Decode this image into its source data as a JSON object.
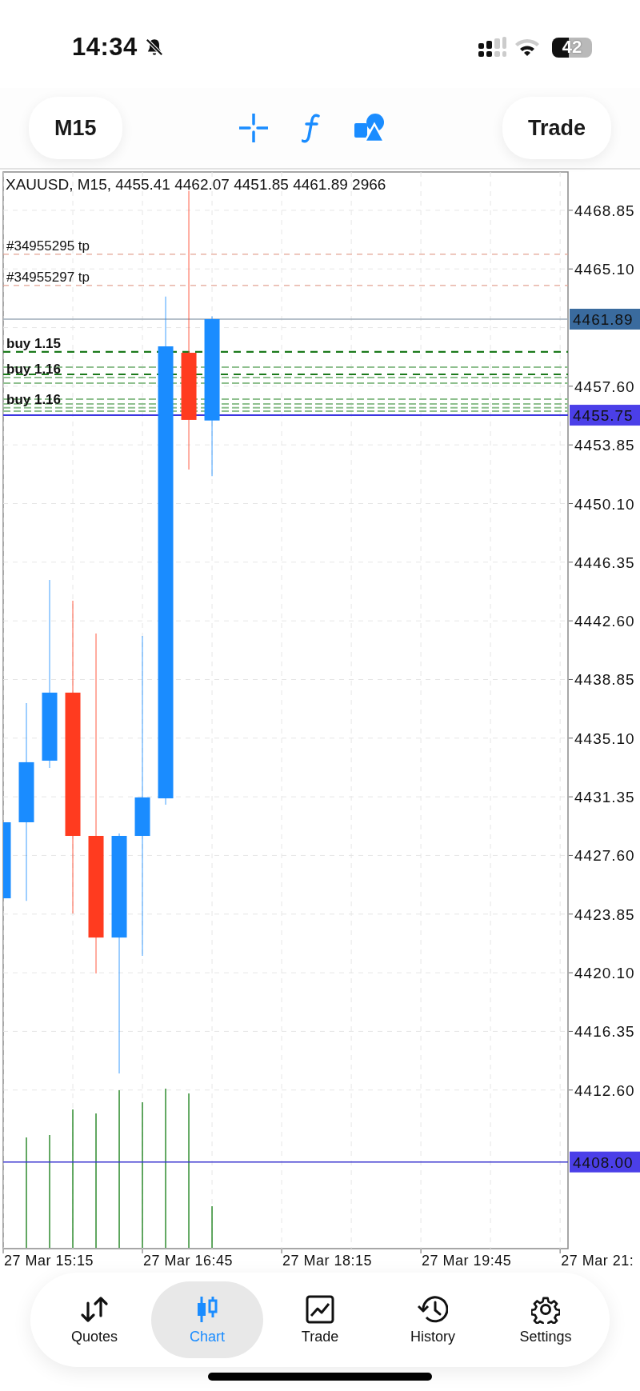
{
  "status_bar": {
    "time": "14:34",
    "battery": "42"
  },
  "toolbar": {
    "timeframe": "M15",
    "trade": "Trade"
  },
  "chart": {
    "title": "XAUUSD, M15, 4455.41 4462.07 4451.85 4461.89 2966",
    "order_labels": [
      "#34955295 tp",
      "#34955297 tp",
      "buy 1.15",
      "buy 1.16",
      "buy 1.16"
    ],
    "price_labels": [
      "4468.85",
      "4465.10",
      "4457.60",
      "4453.85",
      "4450.10",
      "4446.35",
      "4442.60",
      "4438.85",
      "4435.10",
      "4431.35",
      "4427.60",
      "4423.85",
      "4420.10",
      "4416.35",
      "4412.60"
    ],
    "price_tags": [
      {
        "kind": "bid",
        "label": "4461.89"
      },
      {
        "kind": "ask",
        "label": "4455.75"
      },
      {
        "kind": "level",
        "label": "4408.00"
      }
    ],
    "time_labels": [
      "27 Mar 15:15",
      "27 Mar 16:45",
      "27 Mar 18:15",
      "27 Mar 19:45",
      "27 Mar 21:"
    ]
  },
  "tabs": [
    {
      "kind": "quotes",
      "label": "Quotes",
      "selected": false
    },
    {
      "kind": "chart",
      "label": "Chart",
      "selected": true
    },
    {
      "kind": "trade",
      "label": "Trade",
      "selected": false
    },
    {
      "kind": "history",
      "label": "History",
      "selected": false
    },
    {
      "kind": "settings",
      "label": "Settings",
      "selected": false
    }
  ]
}
